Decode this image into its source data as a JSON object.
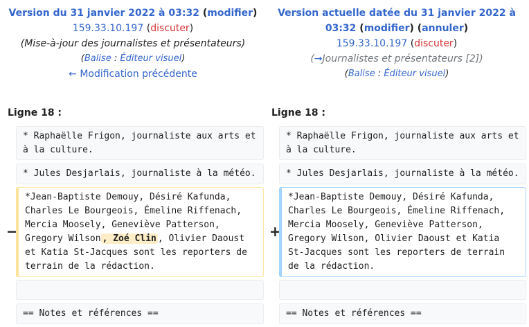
{
  "left_header": {
    "title_prefix": "Version du 31 janvier 2022 à 03:32",
    "open_paren": " (",
    "edit_link": "modifier",
    "close_paren": ")",
    "user_ip": "159.33.10.197",
    "user_open": " (",
    "talk_link": "discuter",
    "user_close": ")",
    "summary": "(Mise-à-jour des journalistes et présentateurs)",
    "tag_open": "(",
    "tag_link": "Balise",
    "tag_sep": " : ",
    "tag_value": "Éditeur visuel",
    "tag_close": ")",
    "prev_link": "← Modification précédente"
  },
  "right_header": {
    "title_line1": "Version actuelle datée du 31 janvier 2022 à",
    "title_line2_prefix": "03:32",
    "edit_link": "modifier",
    "undo_link": "annuler",
    "user_ip": "159.33.10.197",
    "talk_link": "discuter",
    "summary_arrow": "→",
    "summary_text": "Journalistes et présentateurs [2]",
    "tag_link": "Balise",
    "tag_sep": " : ",
    "tag_value": "Éditeur visuel"
  },
  "left_line_label": "Ligne 18 :",
  "right_line_label": "Ligne 18 :",
  "markers": {
    "minus": "−",
    "plus": "+"
  },
  "left_rows": [
    "* Raphaëlle Frigon, journaliste aux arts et à la culture.",
    "* Jules Desjarlais, journaliste à la météo.",
    {
      "before": "*Jean-Baptiste Demouy, Désiré Kafunda, Charles Le Bourgeois, Émeline Riffenach, Mercia Moosely, Geneviève Patterson, Gregory Wilson",
      "deleted": ", Zoé Clin",
      "after": ", Olivier Daoust et Katia St-Jacques sont les reporters de terrain de la rédaction."
    },
    "",
    "== Notes et références =="
  ],
  "right_rows": [
    "* Raphaëlle Frigon, journaliste aux arts et à la culture.",
    "* Jules Desjarlais, journaliste à la météo.",
    "*Jean-Baptiste Demouy, Désiré Kafunda, Charles Le Bourgeois, Émeline Riffenach, Mercia Moosely, Geneviève Patterson, Gregory Wilson, Olivier Daoust et Katia St-Jacques sont les reporters de terrain de la rédaction.",
    "",
    "== Notes et références =="
  ]
}
